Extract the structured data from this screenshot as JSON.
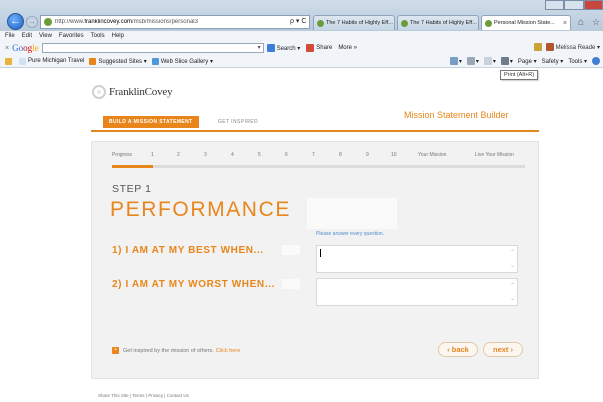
{
  "browser": {
    "url_prefix": "http://www.",
    "url_domain": "franklincovey.com",
    "url_path": "/msb/missions/personal3",
    "address_tools": "ρ ▾ C",
    "tabs": [
      {
        "label": "The 7 Habits of Highly Eff..."
      },
      {
        "label": "The 7 Habits of Highly Eff..."
      },
      {
        "label": "Personal Mission State...",
        "active": true
      }
    ],
    "menu": [
      "File",
      "Edit",
      "View",
      "Favorites",
      "Tools",
      "Help"
    ],
    "google_toolbar": {
      "close": "×",
      "logo_parts": [
        "Go",
        "og",
        "le"
      ],
      "search_label": "Search ▾",
      "share_label": "Share",
      "more_label": "More »",
      "user_label": "Melissa Reade ▾"
    },
    "favorites": [
      {
        "label": "Pure Michigan Travel",
        "icon": "star-icon"
      },
      {
        "label": "Suggested Sites ▾",
        "icon": "suggested-sites-icon"
      },
      {
        "label": "Web Slice Gallery ▾",
        "icon": "web-slice-icon"
      }
    ],
    "command_bar": [
      "Page ▾",
      "Safety ▾",
      "Tools ▾"
    ],
    "tooltip": "Print (Alt+R)"
  },
  "brand": {
    "name": "FranklinCovey"
  },
  "tabs": {
    "build": "BUILD A MISSION STATEMENT",
    "inspired": "GET INSPIRED",
    "builder_title": "Mission Statement Builder"
  },
  "progress": {
    "label": "Progress",
    "steps": [
      "1",
      "2",
      "3",
      "4",
      "5",
      "6",
      "7",
      "8",
      "9",
      "10"
    ],
    "your_mission": "Your Mission",
    "live_mission": "Live Your Mission",
    "fill_fraction": 0.1
  },
  "step": {
    "label": "STEP 1",
    "title": "PERFORMANCE",
    "note": "Please answer every question.",
    "questions": [
      {
        "label": "1) I AM AT MY BEST WHEN...",
        "answer": ""
      },
      {
        "label": "2) I AM AT MY WORST WHEN...",
        "answer": ""
      }
    ]
  },
  "inspire": {
    "icon": "+",
    "text": "Get inspired by the mission of others.",
    "link": "Click here"
  },
  "nav": {
    "back": "‹ back",
    "next": "next ›"
  },
  "footer": "Share This Site | Terms | Privacy | Contact Us",
  "colors": {
    "accent": "#e8861c",
    "note_blue": "#4f8fcc",
    "panel_bg": "#f2f2f2"
  }
}
